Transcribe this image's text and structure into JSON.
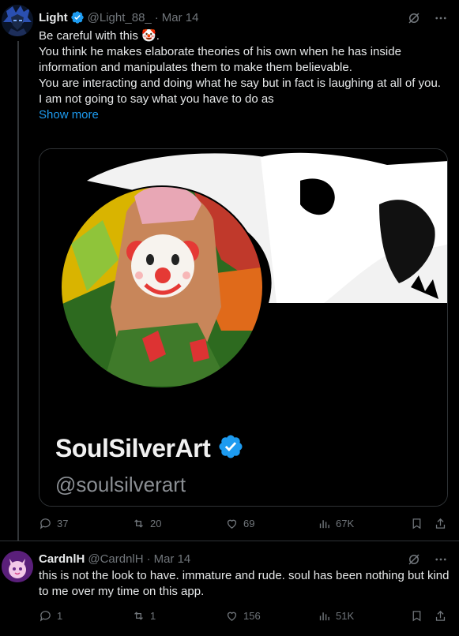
{
  "posts": [
    {
      "author": "Light",
      "handle": "@Light_88_",
      "date": "Mar 14",
      "verified": true,
      "text_lines": [
        "Be careful with this 🤡.",
        "You think he makes elaborate theories of his own when he has inside information and manipulates them to make them believable.",
        "You are interacting and doing what he say but in fact is laughing at all of you.",
        "I am not going to say what you have to do as"
      ],
      "show_more": "Show more",
      "media": {
        "card_name": "SoulSilverArt",
        "card_handle": "@soulsilverart",
        "card_verified": true
      },
      "stats": {
        "replies": "37",
        "reposts": "20",
        "likes": "69",
        "views": "67K"
      }
    },
    {
      "author": "CardnlH",
      "handle": "@CardnlH",
      "date": "Mar 14",
      "verified": false,
      "text": "this is not the look to have. immature and rude. soul has been nothing but kind to me over my time on this app.",
      "stats": {
        "replies": "1",
        "reposts": "1",
        "likes": "156",
        "views": "51K"
      }
    }
  ],
  "colors": {
    "accent": "#1d9bf0",
    "muted": "#71767b",
    "text": "#e7e9ea",
    "background": "#000000"
  }
}
